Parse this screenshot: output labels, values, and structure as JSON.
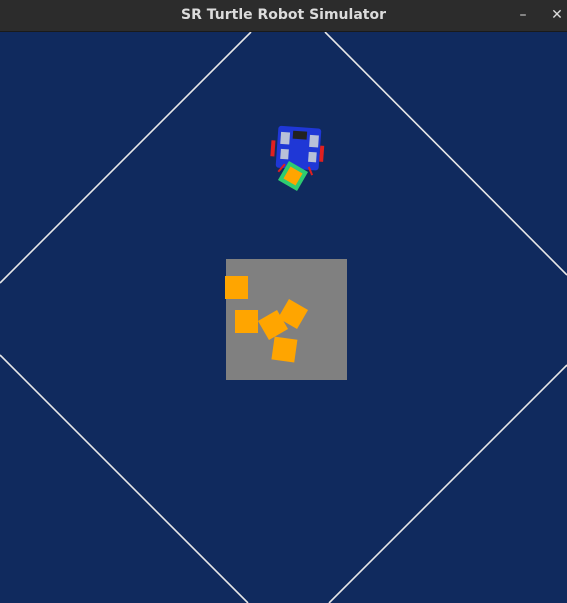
{
  "window": {
    "title": "SR Turtle Robot Simulator",
    "minimize_glyph": "–",
    "close_glyph": "✕"
  },
  "arena": {
    "background_color": "#102a5e",
    "boundary_line_color": "#e8e8e8",
    "center_zone_color": "#808080",
    "token_color": "#ffa500",
    "held_token_outline_color": "#2ecc71",
    "robot_body_color": "#1f37d6",
    "robot_wheel_color": "#e02020",
    "tokens_in_zone": 5,
    "tokens_held_by_robot": 1
  },
  "icons": {
    "minimize": "minimize-icon",
    "close": "close-icon"
  }
}
